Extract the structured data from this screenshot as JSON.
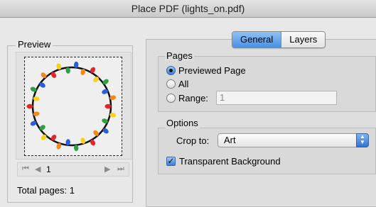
{
  "window": {
    "title": "Place PDF (lights_on.pdf)"
  },
  "preview": {
    "label": "Preview",
    "page_number": "1",
    "total_pages_label": "Total pages: 1",
    "nav": {
      "first": "⏮",
      "prev": "◀",
      "next": "▶",
      "last": "⏭"
    }
  },
  "tabs": [
    {
      "label": "General",
      "active": true
    },
    {
      "label": "Layers",
      "active": false
    }
  ],
  "pages": {
    "title": "Pages",
    "options": [
      {
        "label": "Previewed Page",
        "selected": true
      },
      {
        "label": "All",
        "selected": false
      },
      {
        "label": "Range:",
        "selected": false
      }
    ],
    "range_value": "1"
  },
  "options": {
    "title": "Options",
    "crop_label": "Crop to:",
    "crop_value": "Art",
    "transparent_label": "Transparent Background",
    "transparent_checked": true
  },
  "colors": {
    "accent": "#4a8fe0",
    "panel": "#dedede"
  }
}
